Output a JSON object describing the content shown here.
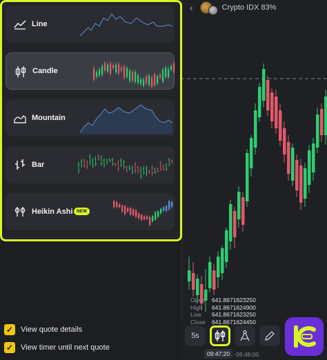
{
  "asset": {
    "name": "Crypto IDX 83%",
    "back_icon": "chevron-left-icon"
  },
  "chart_types": [
    {
      "label": "Line",
      "icon": "line-chart-icon",
      "selected": false
    },
    {
      "label": "Candle",
      "icon": "candle-chart-icon",
      "selected": true
    },
    {
      "label": "Mountain",
      "icon": "mountain-chart-icon",
      "selected": false
    },
    {
      "label": "Bar",
      "icon": "bar-chart-icon",
      "selected": false
    },
    {
      "label": "Heikin Ashi",
      "icon": "heikin-ashi-icon",
      "selected": false,
      "badge": "NEW"
    }
  ],
  "ohlc": {
    "open_label": "Open",
    "open": "641.8671623250",
    "high_label": "High",
    "high": "641.8671624900",
    "low_label": "Low",
    "low": "641.8671623250",
    "close_label": "Close",
    "close": "641.8671624450"
  },
  "toolbar": {
    "timeframe": "5s",
    "chart_type_icon": "candle-chart-icon",
    "draw_tools_icon": "compass-icon",
    "pencil_icon": "pencil-icon",
    "signal_icon": "broadcast-icon"
  },
  "time": {
    "current": "09:47:20",
    "next": "09:48:00"
  },
  "options": {
    "quote_details": "View quote details",
    "timer": "View timer until next quote"
  },
  "colors": {
    "accent": "#d8f526",
    "up": "#2ecc71",
    "down": "#e05a6a",
    "checkbox": "#f1c40f",
    "line": "#5b8fd6"
  }
}
